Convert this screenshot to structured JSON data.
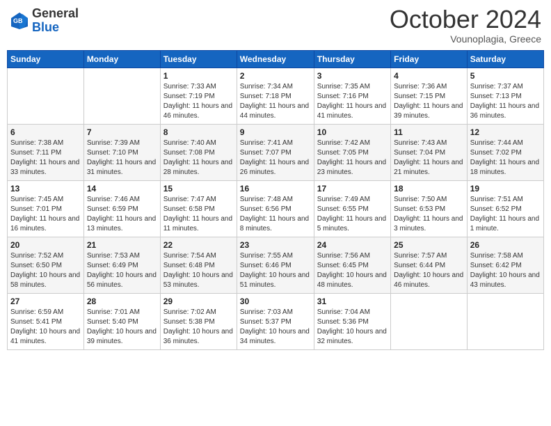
{
  "header": {
    "logo_general": "General",
    "logo_blue": "Blue",
    "month_title": "October 2024",
    "location": "Vounoplagia, Greece"
  },
  "days_of_week": [
    "Sunday",
    "Monday",
    "Tuesday",
    "Wednesday",
    "Thursday",
    "Friday",
    "Saturday"
  ],
  "weeks": [
    [
      {
        "day": "",
        "info": ""
      },
      {
        "day": "",
        "info": ""
      },
      {
        "day": "1",
        "info": "Sunrise: 7:33 AM\nSunset: 7:19 PM\nDaylight: 11 hours and 46 minutes."
      },
      {
        "day": "2",
        "info": "Sunrise: 7:34 AM\nSunset: 7:18 PM\nDaylight: 11 hours and 44 minutes."
      },
      {
        "day": "3",
        "info": "Sunrise: 7:35 AM\nSunset: 7:16 PM\nDaylight: 11 hours and 41 minutes."
      },
      {
        "day": "4",
        "info": "Sunrise: 7:36 AM\nSunset: 7:15 PM\nDaylight: 11 hours and 39 minutes."
      },
      {
        "day": "5",
        "info": "Sunrise: 7:37 AM\nSunset: 7:13 PM\nDaylight: 11 hours and 36 minutes."
      }
    ],
    [
      {
        "day": "6",
        "info": "Sunrise: 7:38 AM\nSunset: 7:11 PM\nDaylight: 11 hours and 33 minutes."
      },
      {
        "day": "7",
        "info": "Sunrise: 7:39 AM\nSunset: 7:10 PM\nDaylight: 11 hours and 31 minutes."
      },
      {
        "day": "8",
        "info": "Sunrise: 7:40 AM\nSunset: 7:08 PM\nDaylight: 11 hours and 28 minutes."
      },
      {
        "day": "9",
        "info": "Sunrise: 7:41 AM\nSunset: 7:07 PM\nDaylight: 11 hours and 26 minutes."
      },
      {
        "day": "10",
        "info": "Sunrise: 7:42 AM\nSunset: 7:05 PM\nDaylight: 11 hours and 23 minutes."
      },
      {
        "day": "11",
        "info": "Sunrise: 7:43 AM\nSunset: 7:04 PM\nDaylight: 11 hours and 21 minutes."
      },
      {
        "day": "12",
        "info": "Sunrise: 7:44 AM\nSunset: 7:02 PM\nDaylight: 11 hours and 18 minutes."
      }
    ],
    [
      {
        "day": "13",
        "info": "Sunrise: 7:45 AM\nSunset: 7:01 PM\nDaylight: 11 hours and 16 minutes."
      },
      {
        "day": "14",
        "info": "Sunrise: 7:46 AM\nSunset: 6:59 PM\nDaylight: 11 hours and 13 minutes."
      },
      {
        "day": "15",
        "info": "Sunrise: 7:47 AM\nSunset: 6:58 PM\nDaylight: 11 hours and 11 minutes."
      },
      {
        "day": "16",
        "info": "Sunrise: 7:48 AM\nSunset: 6:56 PM\nDaylight: 11 hours and 8 minutes."
      },
      {
        "day": "17",
        "info": "Sunrise: 7:49 AM\nSunset: 6:55 PM\nDaylight: 11 hours and 5 minutes."
      },
      {
        "day": "18",
        "info": "Sunrise: 7:50 AM\nSunset: 6:53 PM\nDaylight: 11 hours and 3 minutes."
      },
      {
        "day": "19",
        "info": "Sunrise: 7:51 AM\nSunset: 6:52 PM\nDaylight: 11 hours and 1 minute."
      }
    ],
    [
      {
        "day": "20",
        "info": "Sunrise: 7:52 AM\nSunset: 6:50 PM\nDaylight: 10 hours and 58 minutes."
      },
      {
        "day": "21",
        "info": "Sunrise: 7:53 AM\nSunset: 6:49 PM\nDaylight: 10 hours and 56 minutes."
      },
      {
        "day": "22",
        "info": "Sunrise: 7:54 AM\nSunset: 6:48 PM\nDaylight: 10 hours and 53 minutes."
      },
      {
        "day": "23",
        "info": "Sunrise: 7:55 AM\nSunset: 6:46 PM\nDaylight: 10 hours and 51 minutes."
      },
      {
        "day": "24",
        "info": "Sunrise: 7:56 AM\nSunset: 6:45 PM\nDaylight: 10 hours and 48 minutes."
      },
      {
        "day": "25",
        "info": "Sunrise: 7:57 AM\nSunset: 6:44 PM\nDaylight: 10 hours and 46 minutes."
      },
      {
        "day": "26",
        "info": "Sunrise: 7:58 AM\nSunset: 6:42 PM\nDaylight: 10 hours and 43 minutes."
      }
    ],
    [
      {
        "day": "27",
        "info": "Sunrise: 6:59 AM\nSunset: 5:41 PM\nDaylight: 10 hours and 41 minutes."
      },
      {
        "day": "28",
        "info": "Sunrise: 7:01 AM\nSunset: 5:40 PM\nDaylight: 10 hours and 39 minutes."
      },
      {
        "day": "29",
        "info": "Sunrise: 7:02 AM\nSunset: 5:38 PM\nDaylight: 10 hours and 36 minutes."
      },
      {
        "day": "30",
        "info": "Sunrise: 7:03 AM\nSunset: 5:37 PM\nDaylight: 10 hours and 34 minutes."
      },
      {
        "day": "31",
        "info": "Sunrise: 7:04 AM\nSunset: 5:36 PM\nDaylight: 10 hours and 32 minutes."
      },
      {
        "day": "",
        "info": ""
      },
      {
        "day": "",
        "info": ""
      }
    ]
  ]
}
